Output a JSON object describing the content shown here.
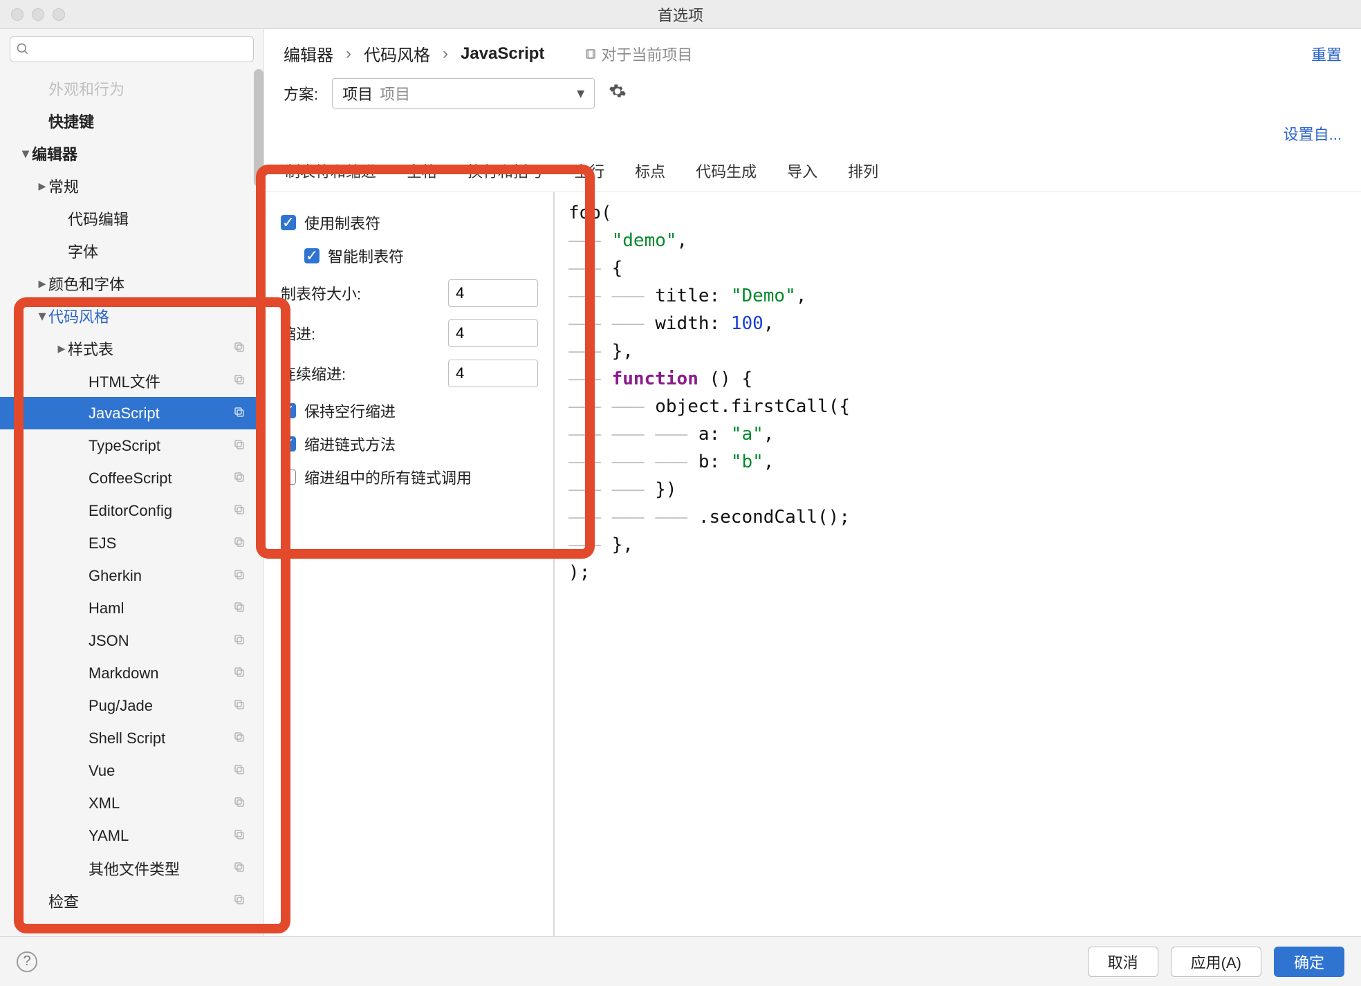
{
  "window": {
    "title": "首选项"
  },
  "sidebar": {
    "search_placeholder": "",
    "items": [
      {
        "label": "外观和行为",
        "indent": 1,
        "chev": "",
        "bold": false,
        "cut": true
      },
      {
        "label": "快捷键",
        "indent": 1,
        "chev": "",
        "bold": true
      },
      {
        "label": "编辑器",
        "indent": 0,
        "chev": "v",
        "bold": true
      },
      {
        "label": "常规",
        "indent": 1,
        "chev": ">",
        "bold": false
      },
      {
        "label": "代码编辑",
        "indent": 2,
        "chev": "",
        "bold": false
      },
      {
        "label": "字体",
        "indent": 2,
        "chev": "",
        "bold": false
      },
      {
        "label": "颜色和字体",
        "indent": 1,
        "chev": ">",
        "bold": false
      },
      {
        "label": "代码风格",
        "indent": 1,
        "chev": "v",
        "bold": false,
        "blue": true
      },
      {
        "label": "样式表",
        "indent": 2,
        "chev": ">",
        "bold": false,
        "copy": true
      },
      {
        "label": "HTML文件",
        "indent": 3,
        "chev": "",
        "bold": false,
        "copy": true
      },
      {
        "label": "JavaScript",
        "indent": 3,
        "chev": "",
        "bold": false,
        "copy": true,
        "selected": true
      },
      {
        "label": "TypeScript",
        "indent": 3,
        "chev": "",
        "bold": false,
        "copy": true
      },
      {
        "label": "CoffeeScript",
        "indent": 3,
        "chev": "",
        "bold": false,
        "copy": true
      },
      {
        "label": "EditorConfig",
        "indent": 3,
        "chev": "",
        "bold": false,
        "copy": true
      },
      {
        "label": "EJS",
        "indent": 3,
        "chev": "",
        "bold": false,
        "copy": true
      },
      {
        "label": "Gherkin",
        "indent": 3,
        "chev": "",
        "bold": false,
        "copy": true
      },
      {
        "label": "Haml",
        "indent": 3,
        "chev": "",
        "bold": false,
        "copy": true
      },
      {
        "label": "JSON",
        "indent": 3,
        "chev": "",
        "bold": false,
        "copy": true
      },
      {
        "label": "Markdown",
        "indent": 3,
        "chev": "",
        "bold": false,
        "copy": true
      },
      {
        "label": "Pug/Jade",
        "indent": 3,
        "chev": "",
        "bold": false,
        "copy": true
      },
      {
        "label": "Shell Script",
        "indent": 3,
        "chev": "",
        "bold": false,
        "copy": true
      },
      {
        "label": "Vue",
        "indent": 3,
        "chev": "",
        "bold": false,
        "copy": true
      },
      {
        "label": "XML",
        "indent": 3,
        "chev": "",
        "bold": false,
        "copy": true
      },
      {
        "label": "YAML",
        "indent": 3,
        "chev": "",
        "bold": false,
        "copy": true
      },
      {
        "label": "其他文件类型",
        "indent": 3,
        "chev": "",
        "bold": false,
        "copy": true
      },
      {
        "label": "检查",
        "indent": 1,
        "chev": "",
        "bold": false,
        "copy": true
      }
    ]
  },
  "breadcrumbs": {
    "items": [
      "编辑器",
      "代码风格",
      "JavaScript"
    ],
    "project_badge": "对于当前项目",
    "reset": "重置"
  },
  "scheme": {
    "label": "方案:",
    "primary": "项目",
    "secondary": "项目"
  },
  "setfrom": "设置自...",
  "tabs": [
    "制表符和缩进",
    "空格",
    "换行和括号",
    "空行",
    "标点",
    "代码生成",
    "导入",
    "排列"
  ],
  "active_tab": 0,
  "settings": {
    "use_tabs": {
      "label": "使用制表符",
      "checked": true
    },
    "smart_tabs": {
      "label": "智能制表符",
      "checked": true
    },
    "tab_size": {
      "label": "制表符大小:",
      "value": "4"
    },
    "indent": {
      "label": "缩进:",
      "value": "4"
    },
    "cont_indent": {
      "label": "连续缩进:",
      "value": "4"
    },
    "keep_blank": {
      "label": "保持空行缩进",
      "checked": true
    },
    "chain_indent": {
      "label": "缩进链式方法",
      "checked": true
    },
    "chain_group": {
      "label": "缩进组中的所有链式调用",
      "checked": false
    }
  },
  "preview": {
    "lines": [
      {
        "guide": "",
        "tokens": [
          [
            "id",
            "foo("
          ]
        ]
      },
      {
        "guide": "——— ",
        "tokens": [
          [
            "str",
            "\"demo\""
          ],
          [
            "id",
            ","
          ]
        ]
      },
      {
        "guide": "——— ",
        "tokens": [
          [
            "id",
            "{"
          ]
        ]
      },
      {
        "guide": "——— ——— ",
        "tokens": [
          [
            "id",
            "title: "
          ],
          [
            "str",
            "\"Demo\""
          ],
          [
            "id",
            ","
          ]
        ]
      },
      {
        "guide": "——— ——— ",
        "tokens": [
          [
            "id",
            "width: "
          ],
          [
            "num",
            "100"
          ],
          [
            "id",
            ","
          ]
        ]
      },
      {
        "guide": "——— ",
        "tokens": [
          [
            "id",
            "},"
          ]
        ]
      },
      {
        "guide": "——— ",
        "tokens": [
          [
            "kw",
            "function "
          ],
          [
            "id",
            "() {"
          ]
        ]
      },
      {
        "guide": "——— ——— ",
        "tokens": [
          [
            "id",
            "object.firstCall({"
          ]
        ]
      },
      {
        "guide": "——— ——— ——— ",
        "tokens": [
          [
            "id",
            "a: "
          ],
          [
            "str",
            "\"a\""
          ],
          [
            "id",
            ","
          ]
        ]
      },
      {
        "guide": "——— ——— ——— ",
        "tokens": [
          [
            "id",
            "b: "
          ],
          [
            "str",
            "\"b\""
          ],
          [
            "id",
            ","
          ]
        ]
      },
      {
        "guide": "——— ——— ",
        "tokens": [
          [
            "id",
            "})"
          ]
        ]
      },
      {
        "guide": "——— ——— ——— ",
        "tokens": [
          [
            "id",
            ".secondCall();"
          ]
        ]
      },
      {
        "guide": "——— ",
        "tokens": [
          [
            "id",
            "},"
          ]
        ]
      },
      {
        "guide": "",
        "tokens": [
          [
            "id",
            ");"
          ]
        ]
      }
    ]
  },
  "footer": {
    "cancel": "取消",
    "apply": "应用(A)",
    "ok": "确定"
  }
}
